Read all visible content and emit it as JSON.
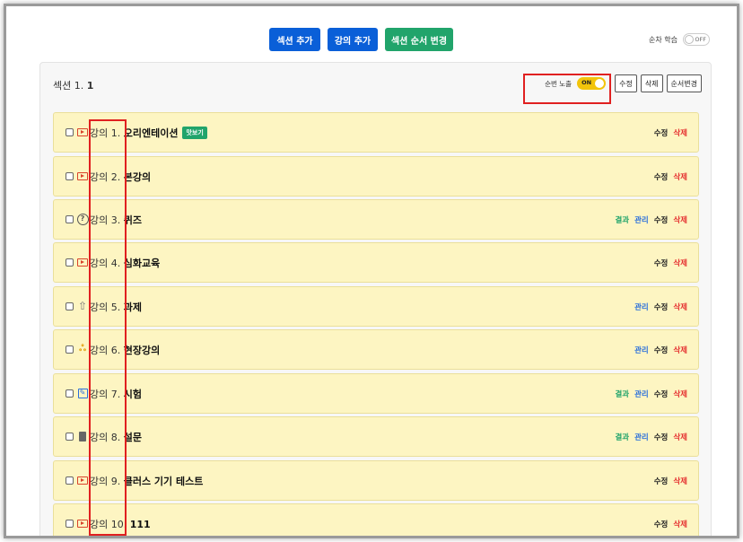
{
  "toolbar": {
    "add_section": "섹션 추가",
    "add_lecture": "강의 추가",
    "reorder_sections": "섹션 순서 변경",
    "sequential_learning_label": "순차 학습",
    "sequential_learning_state": "OFF"
  },
  "section": {
    "title_prefix": "섹션 1.",
    "title_num": "1",
    "exposure_label": "순번 노출",
    "exposure_state": "ON",
    "edit": "수정",
    "delete": "삭제",
    "reorder": "순서변경"
  },
  "action_labels": {
    "result": "결과",
    "manage": "관리",
    "edit": "수정",
    "delete": "삭제"
  },
  "lectures": [
    {
      "prefix": "강의 1.",
      "title": "오리엔테이션",
      "icon": "video-icon",
      "badge": "맛보기"
    },
    {
      "prefix": "강의 2.",
      "title": "본강의",
      "icon": "video-icon"
    },
    {
      "prefix": "강의 3.",
      "title": "퀴즈",
      "icon": "question-icon"
    },
    {
      "prefix": "강의 4.",
      "title": "심화교육",
      "icon": "video-icon"
    },
    {
      "prefix": "강의 5.",
      "title": "과제",
      "icon": "upload-icon"
    },
    {
      "prefix": "강의 6.",
      "title": "현장강의",
      "icon": "people-icon"
    },
    {
      "prefix": "강의 7.",
      "title": "시험",
      "icon": "edit-icon"
    },
    {
      "prefix": "강의 8.",
      "title": "설문",
      "icon": "clipboard-icon"
    },
    {
      "prefix": "강의 9.",
      "title": "클러스 기기 테스트",
      "icon": "video-icon"
    },
    {
      "prefix": "강의 10.",
      "title": "111",
      "icon": "video-icon"
    }
  ],
  "colors": {
    "primary_blue": "#0a5fd8",
    "green": "#21a46b",
    "row_bg": "#fdf5c2",
    "toggle_on": "#f2c40b",
    "delete_red": "#e53030",
    "highlight_red": "#e02020"
  }
}
